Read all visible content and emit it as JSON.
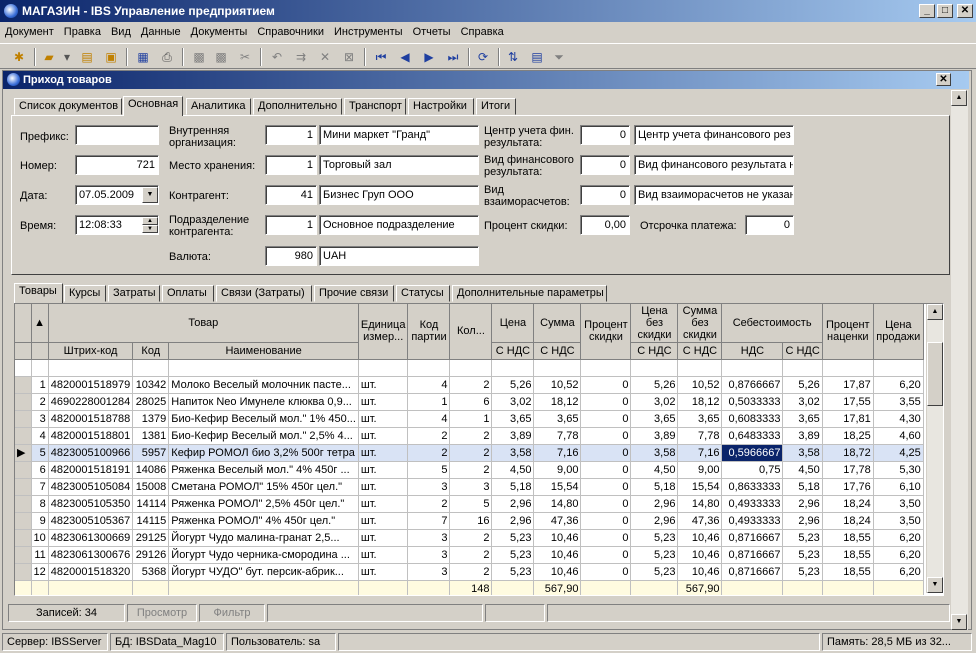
{
  "app": {
    "title": "МАГАЗИН - IBS Управление предприятием"
  },
  "menu": [
    "Документ",
    "Правка",
    "Вид",
    "Данные",
    "Документы",
    "Справочники",
    "Инструменты",
    "Отчеты",
    "Справка"
  ],
  "window": {
    "title": "Приход товаров"
  },
  "tabs": [
    "Список документов",
    "Основная",
    "Аналитика",
    "Дополнительно",
    "Транспорт",
    "Настройки",
    "Итоги"
  ],
  "form": {
    "prefix_label": "Префикс:",
    "prefix_value": "",
    "number_label": "Номер:",
    "number_value": "721",
    "date_label": "Дата:",
    "date_value": "07.05.2009",
    "time_label": "Время:",
    "time_value": "12:08:33",
    "internal_org_label": "Внутренняя организация:",
    "internal_org_code": "1",
    "internal_org_name": "Мини маркет \"Гранд\"",
    "storage_label": "Место хранения:",
    "storage_code": "1",
    "storage_name": "Торговый зал",
    "contractor_label": "Контрагент:",
    "contractor_code": "41",
    "contractor_name": "Бизнес Груп ООО",
    "division_label": "Подразделение контрагента:",
    "division_code": "1",
    "division_name": "Основное подразделение",
    "currency_label": "Валюта:",
    "currency_code": "980",
    "currency_name": "UAH",
    "fin_center_label": "Центр учета фин. результата:",
    "fin_center_code": "0",
    "fin_center_name": "Центр учета финансового рез",
    "fin_type_label": "Вид финансового результата:",
    "fin_type_code": "0",
    "fin_type_name": "Вид финансового результата н",
    "settle_label": "Вид взаиморасчетов:",
    "settle_code": "0",
    "settle_name": "Вид взаиморасчетов не указан",
    "discount_label": "Процент скидки:",
    "discount_value": "0,00",
    "delay_label": "Отсрочка платежа:",
    "delay_value": "0"
  },
  "subtabs": [
    "Товары",
    "Курсы",
    "Затраты",
    "Оплаты",
    "Связи (Затраты)",
    "Прочие связи",
    "Статусы",
    "Дополнительные параметры"
  ],
  "grid": {
    "group_headers": {
      "tovar": "Товар",
      "unit": "Единица измер...",
      "batch": "Код партии",
      "qty": "Кол...",
      "price": "Цена",
      "sum": "Сумма",
      "disc": "Процент скидки",
      "price_nd": "Цена без скидки",
      "sum_nd": "Сумма без скидки",
      "cost": "Себестоимость",
      "markup": "Процент наценки",
      "sale": "Цена продажи"
    },
    "sub_headers": {
      "barcode": "Штрих-код",
      "code": "Код",
      "name": "Наименование",
      "price_vat": "С НДС",
      "sum_vat": "С НДС",
      "price_nd_vat": "С НДС",
      "sum_nd_vat": "С НДС",
      "cost_nds": "НДС",
      "cost_vat": "С НДС"
    },
    "rows": [
      [
        "1",
        "4820001518979",
        "10342",
        "Молоко Веселый молочник пасте...",
        "шт.",
        "4",
        "2",
        "5,26",
        "10,52",
        "0",
        "5,26",
        "10,52",
        "0,8766667",
        "5,26",
        "17,87",
        "6,20"
      ],
      [
        "2",
        "4690228001284",
        "28025",
        "Напиток Neo Имунеле клюква 0,9...",
        "шт.",
        "1",
        "6",
        "3,02",
        "18,12",
        "0",
        "3,02",
        "18,12",
        "0,5033333",
        "3,02",
        "17,55",
        "3,55"
      ],
      [
        "3",
        "4820001518788",
        "1379",
        "Био-Кефир Веселый мол.\" 1% 450...",
        "шт.",
        "4",
        "1",
        "3,65",
        "3,65",
        "0",
        "3,65",
        "3,65",
        "0,6083333",
        "3,65",
        "17,81",
        "4,30"
      ],
      [
        "4",
        "4820001518801",
        "1381",
        "Био-Кефир Веселый мол.\" 2,5% 4...",
        "шт.",
        "2",
        "2",
        "3,89",
        "7,78",
        "0",
        "3,89",
        "7,78",
        "0,6483333",
        "3,89",
        "18,25",
        "4,60"
      ],
      [
        "5",
        "4823005100966",
        "5957",
        "Кефир РОМОЛ био 3,2% 500г тетра",
        "шт.",
        "2",
        "2",
        "3,58",
        "7,16",
        "0",
        "3,58",
        "7,16",
        "0,5966667",
        "3,58",
        "18,72",
        "4,25"
      ],
      [
        "6",
        "4820001518191",
        "14086",
        "Ряженка Веселый мол.\" 4% 450г ...",
        "шт.",
        "5",
        "2",
        "4,50",
        "9,00",
        "0",
        "4,50",
        "9,00",
        "0,75",
        "4,50",
        "17,78",
        "5,30"
      ],
      [
        "7",
        "4823005105084",
        "15008",
        "Сметана РОМОЛ\" 15% 450г цел.\"",
        "шт.",
        "3",
        "3",
        "5,18",
        "15,54",
        "0",
        "5,18",
        "15,54",
        "0,8633333",
        "5,18",
        "17,76",
        "6,10"
      ],
      [
        "8",
        "4823005105350",
        "14114",
        "Ряженка РОМОЛ\" 2,5% 450г цел.\"",
        "шт.",
        "2",
        "5",
        "2,96",
        "14,80",
        "0",
        "2,96",
        "14,80",
        "0,4933333",
        "2,96",
        "18,24",
        "3,50"
      ],
      [
        "9",
        "4823005105367",
        "14115",
        "Ряженка РОМОЛ\" 4% 450г цел.\"",
        "шт.",
        "7",
        "16",
        "2,96",
        "47,36",
        "0",
        "2,96",
        "47,36",
        "0,4933333",
        "2,96",
        "18,24",
        "3,50"
      ],
      [
        "10",
        "4823061300669",
        "29125",
        "Йогурт Чудо малина-гранат 2,5...",
        "шт.",
        "3",
        "2",
        "5,23",
        "10,46",
        "0",
        "5,23",
        "10,46",
        "0,8716667",
        "5,23",
        "18,55",
        "6,20"
      ],
      [
        "11",
        "4823061300676",
        "29126",
        "Йогурт Чудо черника-смородина ...",
        "шт.",
        "3",
        "2",
        "5,23",
        "10,46",
        "0",
        "5,23",
        "10,46",
        "0,8716667",
        "5,23",
        "18,55",
        "6,20"
      ],
      [
        "12",
        "4820001518320",
        "5368",
        "Йогурт ЧУДО\" бут. персик-абрик...",
        "шт.",
        "3",
        "2",
        "5,23",
        "10,46",
        "0",
        "5,23",
        "10,46",
        "0,8716667",
        "5,23",
        "18,55",
        "6,20"
      ]
    ],
    "totals": {
      "qty": "148",
      "sum": "567,90",
      "sum_nd": "567,90"
    }
  },
  "records": {
    "label": "Записей: 34",
    "view": "Просмотр",
    "filter": "Фильтр"
  },
  "status": {
    "server": "Сервер: IBSServer",
    "db": "БД: IBSData_Mag10",
    "user": "Пользователь: sa",
    "memory": "Память: 28,5 МБ из 32..."
  }
}
